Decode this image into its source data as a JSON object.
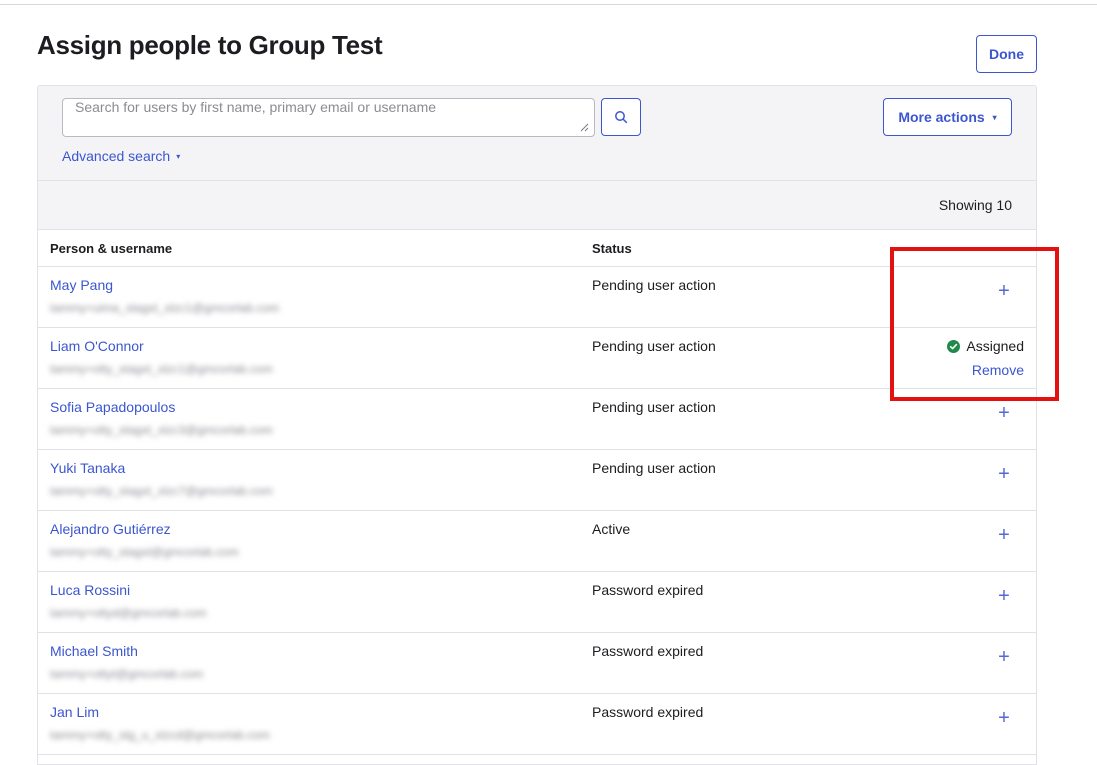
{
  "page": {
    "title": "Assign people to Group Test",
    "done_label": "Done"
  },
  "search": {
    "placeholder": "Search for users by first name, primary email or username",
    "advanced_label": "Advanced search",
    "more_actions_label": "More actions",
    "caret_glyph": "▾"
  },
  "table": {
    "showing": "Showing 10",
    "columns": {
      "person": "Person & username",
      "status": "Status"
    },
    "add_glyph": "+",
    "assigned_label": "Assigned",
    "remove_label": "Remove",
    "rows": [
      {
        "name": "May Pang",
        "username": "tammy+uima_stagxt_xlzc1@gmcorlab.com",
        "status": "Pending user action",
        "assigned": false
      },
      {
        "name": "Liam O'Connor",
        "username": "tammy+otty_stagxt_xlzc1@gmcorlab.com",
        "status": "Pending user action",
        "assigned": true
      },
      {
        "name": "Sofia Papadopoulos",
        "username": "tammy+otty_stagxt_xlzc3@gmcorlab.com",
        "status": "Pending user action",
        "assigned": false
      },
      {
        "name": "Yuki Tanaka",
        "username": "tammy+otty_stagxt_xlzc7@gmcorlab.com",
        "status": "Pending user action",
        "assigned": false
      },
      {
        "name": "Alejandro Gutiérrez",
        "username": "tammy+otty_stagxt@gmcorlab.com",
        "status": "Active",
        "assigned": false
      },
      {
        "name": "Luca Rossini",
        "username": "tammy+ottyd@gmcorlab.com",
        "status": "Password expired",
        "assigned": false
      },
      {
        "name": "Michael Smith",
        "username": "tammy+ottyt@gmcorlab.com",
        "status": "Password expired",
        "assigned": false
      },
      {
        "name": "Jan Lim",
        "username": "tammy+otty_stg_u_xlzcd@gmcorlab.com",
        "status": "Password expired",
        "assigned": false
      }
    ]
  },
  "colors": {
    "accent": "#3b56cf",
    "assigned_check": "#1f8a4c",
    "highlight": "#e3120f"
  },
  "icons": {
    "search": "search-icon",
    "check": "check-circle-icon",
    "add": "plus-icon"
  }
}
